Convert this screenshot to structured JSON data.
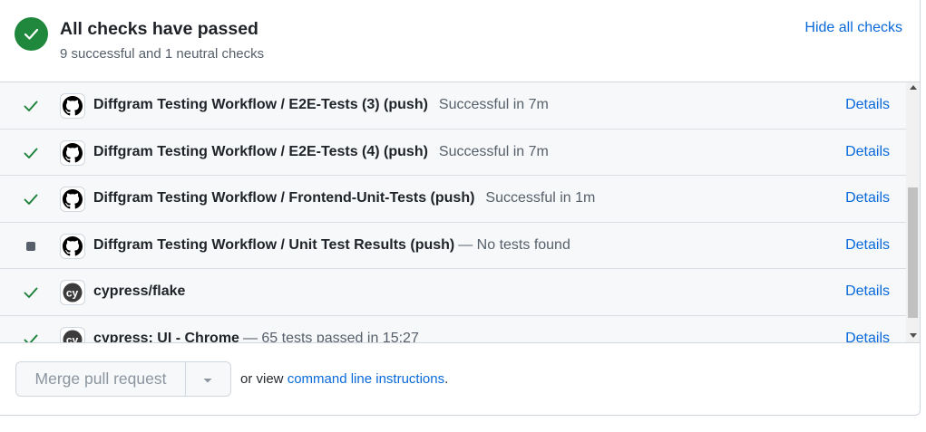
{
  "header": {
    "title": "All checks have passed",
    "subtitle": "9 successful and 1 neutral checks",
    "hide_all_label": "Hide all checks",
    "status_icon": "check-circle-icon",
    "status_color": "#1f883d"
  },
  "checks": [
    {
      "status": "success",
      "app_icon": "github-logo-icon",
      "name": "Diffgram Testing Workflow / E2E-Tests (3) (push)",
      "description": "Successful in 7m",
      "details_label": "Details"
    },
    {
      "status": "success",
      "app_icon": "github-logo-icon",
      "name": "Diffgram Testing Workflow / E2E-Tests (4) (push)",
      "description": "Successful in 7m",
      "details_label": "Details"
    },
    {
      "status": "success",
      "app_icon": "github-logo-icon",
      "name": "Diffgram Testing Workflow / Frontend-Unit-Tests (push)",
      "description": "Successful in 1m",
      "details_label": "Details"
    },
    {
      "status": "neutral",
      "app_icon": "github-logo-icon",
      "name": "Diffgram Testing Workflow / Unit Test Results (push)",
      "description": "— No tests found",
      "details_label": "Details"
    },
    {
      "status": "success",
      "app_icon": "cypress-logo-icon",
      "name": "cypress/flake",
      "description": "",
      "details_label": "Details"
    },
    {
      "status": "success",
      "app_icon": "cypress-logo-icon",
      "name": "cypress: UI - Chrome",
      "description": "— 65 tests passed in 15:27",
      "details_label": "Details"
    }
  ],
  "merge": {
    "button_label": "Merge pull request",
    "note_prefix": "or view ",
    "note_link": "command line instructions",
    "note_suffix": "."
  },
  "colors": {
    "success": "#1a7f37",
    "neutral": "#57606a",
    "link": "#0969da"
  }
}
